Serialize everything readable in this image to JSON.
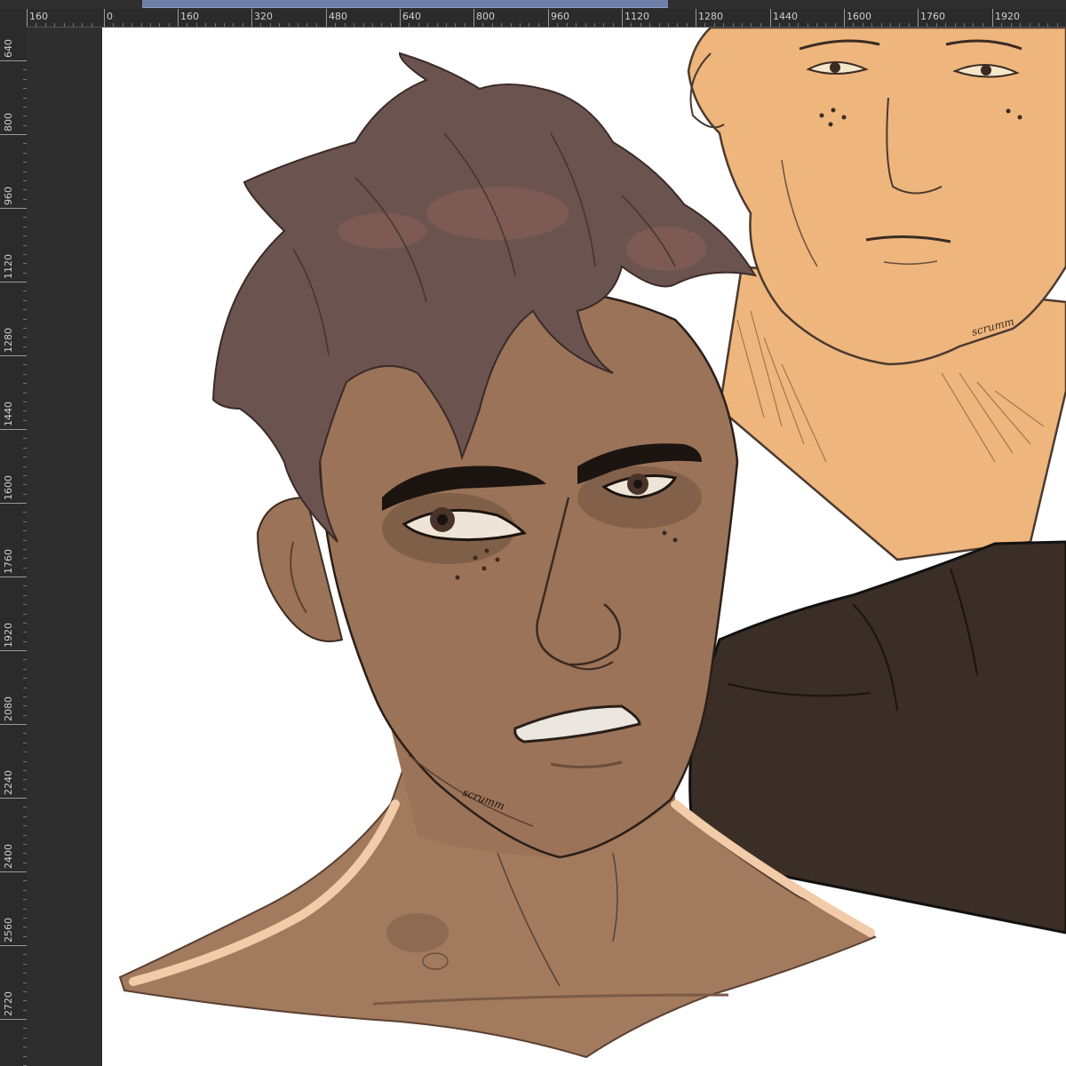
{
  "rulers": {
    "horizontal": [
      "160",
      "0",
      "160",
      "320",
      "480",
      "640",
      "800",
      "960",
      "1120",
      "1280",
      "1440",
      "1600",
      "1760",
      "1920"
    ],
    "vertical": [
      "640",
      "800",
      "960",
      "1120",
      "1280",
      "1440",
      "1600",
      "1760",
      "1920",
      "2080",
      "2240",
      "2400",
      "2560",
      "2720"
    ]
  },
  "artwork": {
    "signature_front": "scrumm",
    "signature_back": "scrumm"
  },
  "colors": {
    "workspace": "#2e2e2e",
    "ruler": "#2b2b2b",
    "paper": "#ffffff",
    "skin_front": "#9b7358",
    "skin_back": "#eeb57c",
    "hair": "#6b5450",
    "shirt": "#3b2e26"
  }
}
